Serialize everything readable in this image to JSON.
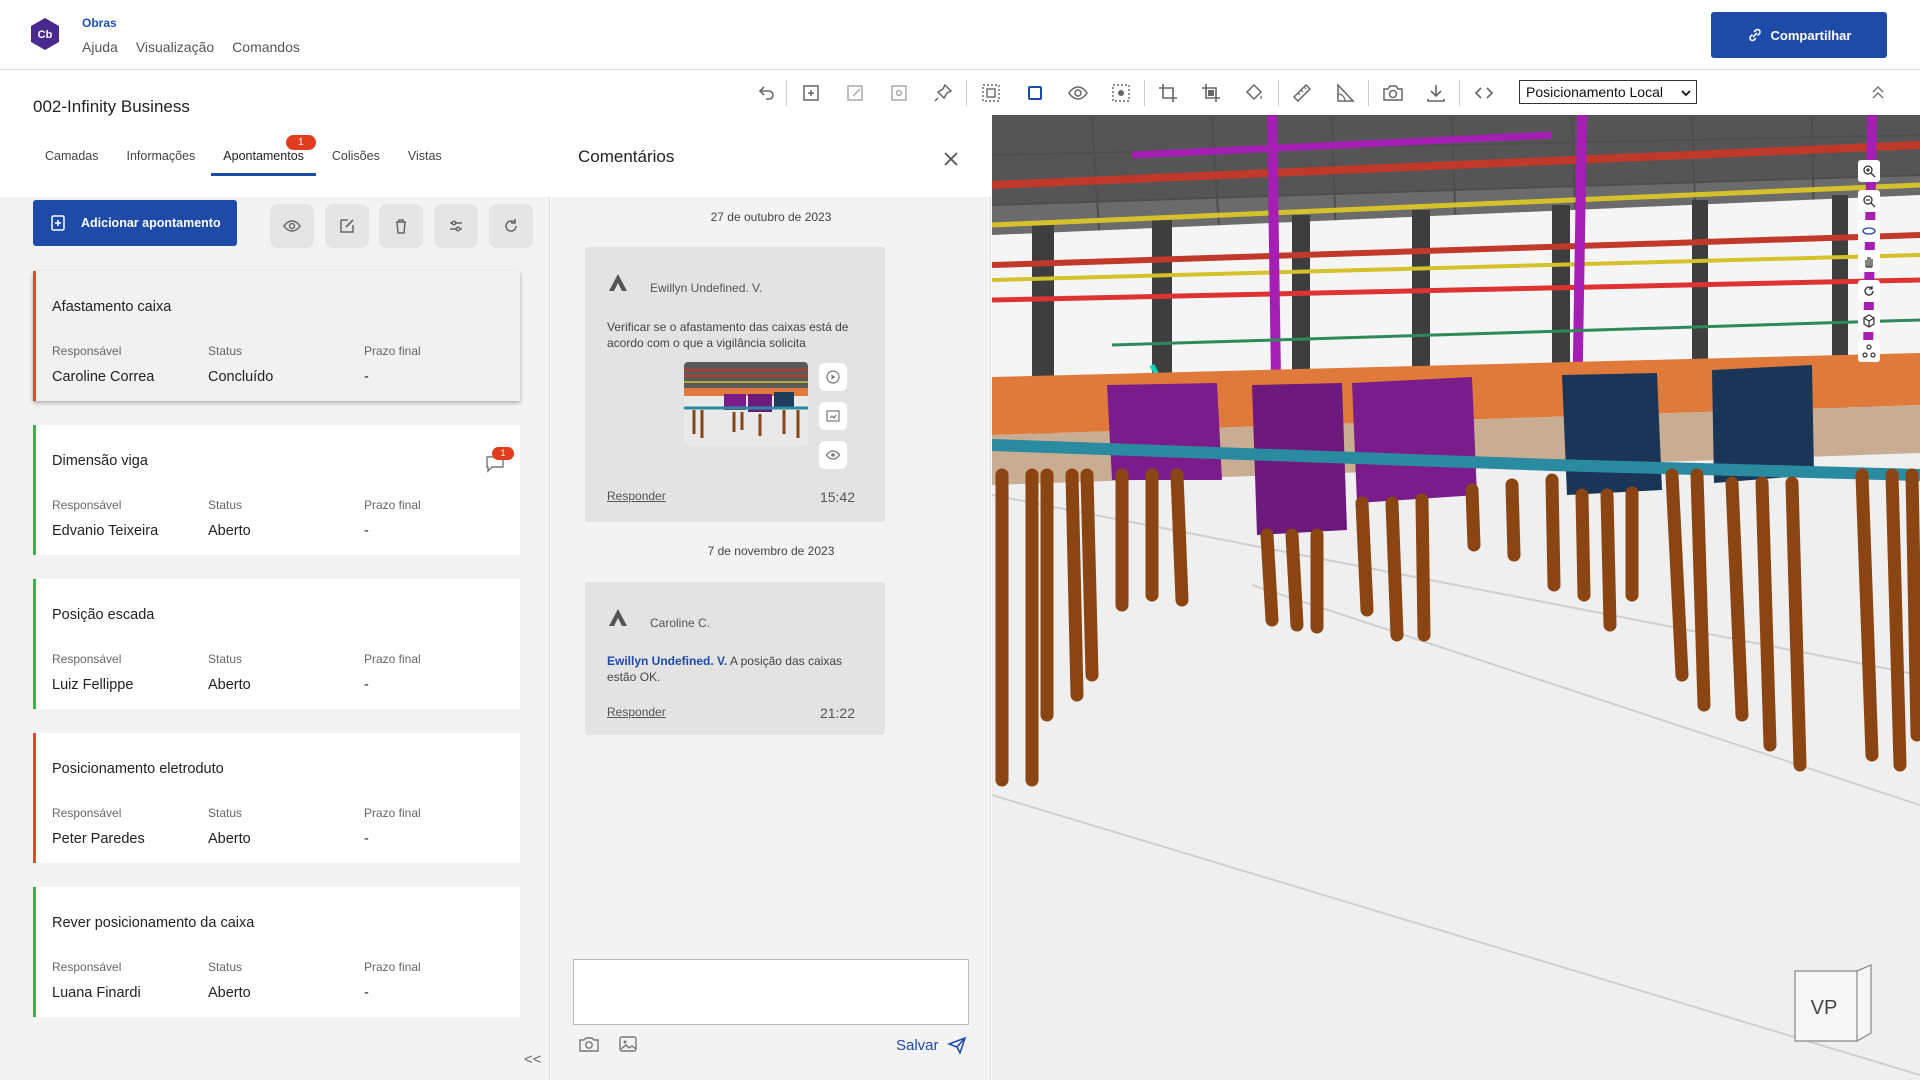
{
  "app": {
    "name": "Obras",
    "menu": [
      "Ajuda",
      "Visualização",
      "Comandos"
    ],
    "logo_text": "Cb",
    "share_label": "Compartilhar"
  },
  "project": {
    "title": "002-Infinity Business",
    "tabs": [
      {
        "label": "Camadas"
      },
      {
        "label": "Informações"
      },
      {
        "label": "Apontamentos",
        "badge": "1",
        "active": true
      },
      {
        "label": "Colisões"
      },
      {
        "label": "Vistas"
      }
    ],
    "add_label": "Adicionar apontamento"
  },
  "columns": {
    "responsible": "Responsável",
    "status": "Status",
    "deadline": "Prazo final"
  },
  "issues": [
    {
      "title": "Afastamento caixa",
      "responsible": "Caroline Correa",
      "status": "Concluído",
      "deadline": "-",
      "state": "red",
      "selected": true
    },
    {
      "title": "Dimensão viga",
      "responsible": "Edvanio Teixeira",
      "status": "Aberto",
      "deadline": "-",
      "state": "green",
      "comments": "1"
    },
    {
      "title": "Posição escada",
      "responsible": "Luiz Fellippe",
      "status": "Aberto",
      "deadline": "-",
      "state": "green"
    },
    {
      "title": "Posicionamento eletroduto",
      "responsible": "Peter Paredes",
      "status": "Aberto",
      "deadline": "-",
      "state": "red"
    },
    {
      "title": "Rever posicionamento da caixa",
      "responsible": "Luana Finardi",
      "status": "Aberto",
      "deadline": "-",
      "state": "green"
    }
  ],
  "collapse_label": "<<",
  "comments": {
    "title": "Comentários",
    "threads": [
      {
        "date": "27 de outubro de 2023",
        "author": "Ewillyn Undefined. V.",
        "text": "Verificar se o afastamento das caixas está de acordo com o que a vigilância solicita",
        "reply": "Responder",
        "time": "15:42"
      },
      {
        "date": "7 de novembro de 2023",
        "author": "Caroline C.",
        "mention": "Ewillyn Undefined. V.",
        "text": " A posição das caixas estão OK.",
        "reply": "Responder",
        "time": "21:22"
      }
    ],
    "save_label": "Salvar"
  },
  "viewer": {
    "positioning": "Posicionamento Local",
    "cube_label": "VP"
  },
  "colors": {
    "primary": "#1e4aa8",
    "badge": "#e23b1e",
    "open": "#3bb14a",
    "alert": "#e04a2a"
  }
}
